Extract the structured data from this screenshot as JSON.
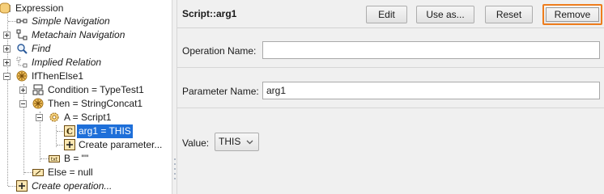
{
  "tree": {
    "items": [
      {
        "label": "Expression",
        "icon": "expression-icon"
      },
      {
        "label": "Simple Navigation",
        "icon": "simple-navigation-icon"
      },
      {
        "label": "Metachain Navigation",
        "icon": "metachain-navigation-icon"
      },
      {
        "label": "Find",
        "icon": "find-icon"
      },
      {
        "label": "Implied Relation",
        "icon": "implied-relation-icon"
      },
      {
        "label": "IfThenElse1",
        "icon": "if-then-else-icon"
      },
      {
        "label": "Condition = TypeTest1",
        "icon": "type-test-icon"
      },
      {
        "label": "Then = StringConcat1",
        "icon": "string-concat-icon"
      },
      {
        "label": "A = Script1",
        "icon": "script-gear-icon"
      },
      {
        "label": "arg1 = THIS",
        "icon": "parameter-icon",
        "selected": true
      },
      {
        "label": "Create parameter...",
        "icon": "create-plus-icon"
      },
      {
        "label": "B = \"\"",
        "icon": "string-value-icon"
      },
      {
        "label": "Else = null",
        "icon": "null-value-icon"
      },
      {
        "label": "Create operation...",
        "icon": "create-plus-icon"
      }
    ]
  },
  "panel": {
    "title": "Script::arg1",
    "buttons": {
      "edit": "Edit",
      "use_as": "Use as...",
      "reset": "Reset",
      "remove": "Remove"
    },
    "operation_name": {
      "label": "Operation Name:",
      "value": ""
    },
    "parameter_name": {
      "label": "Parameter Name:",
      "value": "arg1"
    },
    "value": {
      "label": "Value:",
      "selected": "THIS"
    }
  },
  "colors": {
    "selection": "#1e6fd9",
    "focus_ring": "#ee7d1d",
    "panel_bg": "#f0f0f0"
  }
}
